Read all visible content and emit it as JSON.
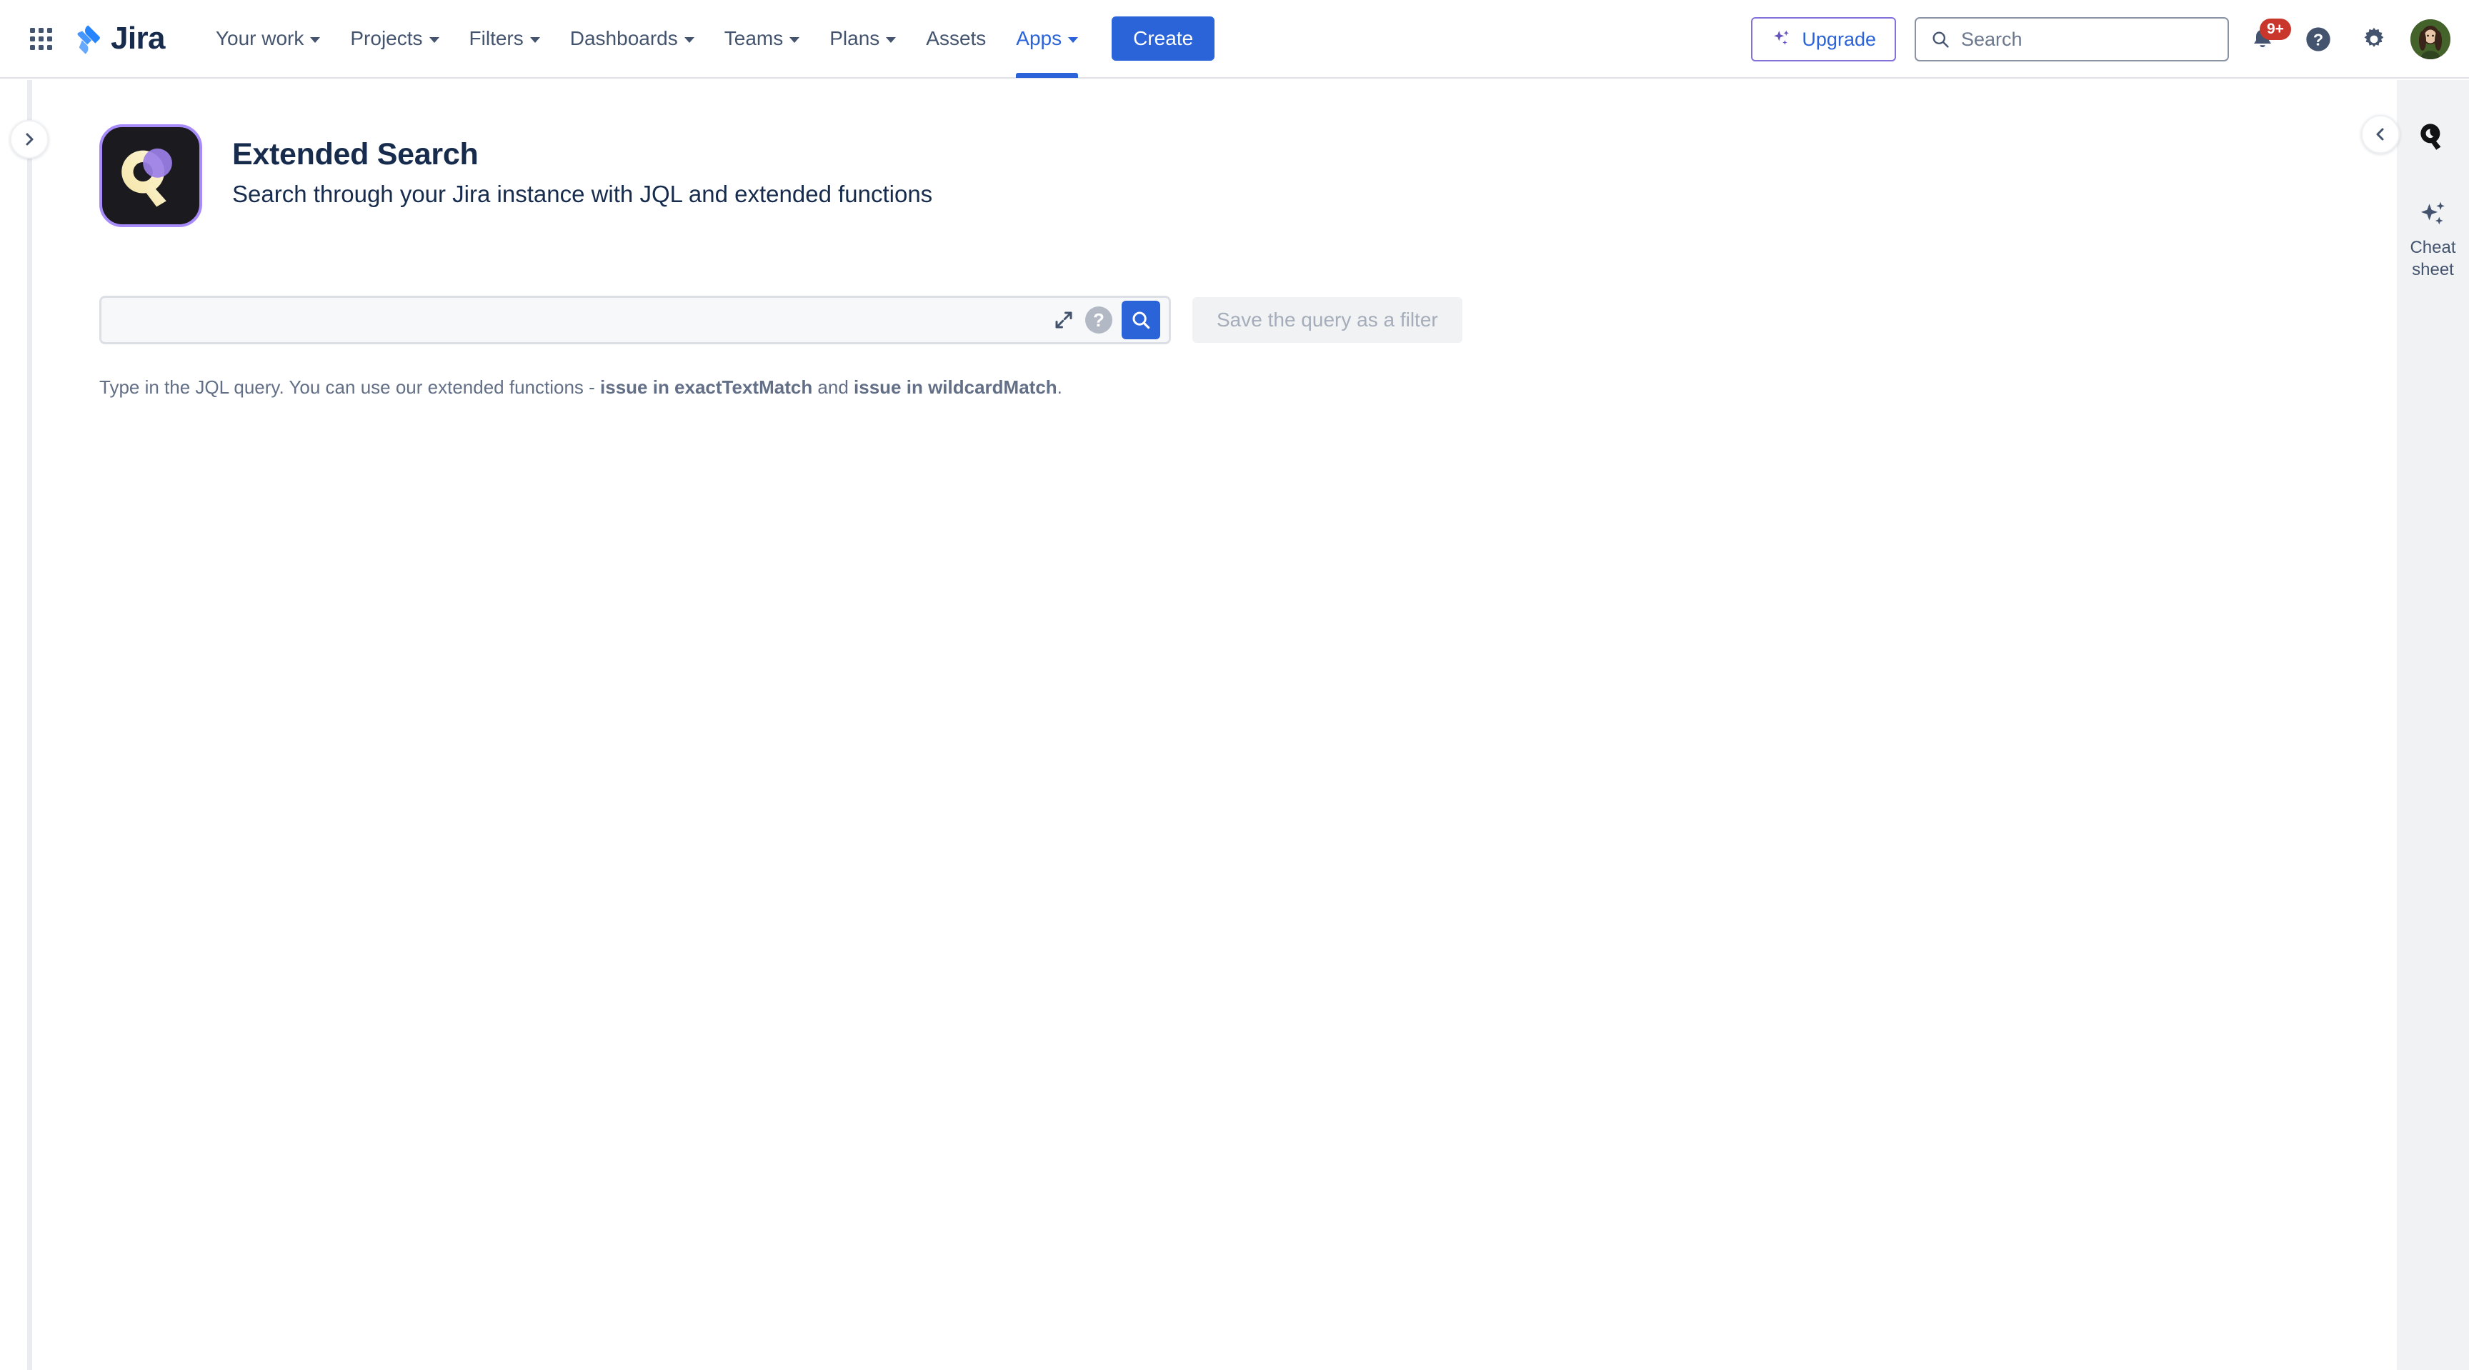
{
  "nav": {
    "app_switcher_icon": "grid-apps-icon",
    "brand": "Jira",
    "items": [
      {
        "label": "Your work",
        "has_dropdown": true,
        "active": false
      },
      {
        "label": "Projects",
        "has_dropdown": true,
        "active": false
      },
      {
        "label": "Filters",
        "has_dropdown": true,
        "active": false
      },
      {
        "label": "Dashboards",
        "has_dropdown": true,
        "active": false
      },
      {
        "label": "Teams",
        "has_dropdown": true,
        "active": false
      },
      {
        "label": "Plans",
        "has_dropdown": true,
        "active": false
      },
      {
        "label": "Assets",
        "has_dropdown": false,
        "active": false
      },
      {
        "label": "Apps",
        "has_dropdown": true,
        "active": true
      }
    ],
    "create_label": "Create",
    "upgrade_label": "Upgrade",
    "upgrade_icon": "sparkles-icon",
    "search_placeholder": "Search",
    "search_icon": "search-icon",
    "notifications_icon": "bell-icon",
    "notifications_badge": "9+",
    "help_icon": "question-circle-icon",
    "settings_icon": "gear-icon",
    "avatar_icon": "user-avatar"
  },
  "left_rail": {
    "expand_icon": "chevron-right-icon"
  },
  "right_rail": {
    "collapse_icon": "chevron-left-icon",
    "app_logo_icon": "extended-search-q-icon",
    "items": [
      {
        "icon": "sparkles-icon",
        "label_line1": "Cheat",
        "label_line2": "sheet"
      }
    ]
  },
  "app": {
    "logo_icon": "extended-search-logo",
    "title": "Extended Search",
    "subtitle": "Search through your Jira instance with JQL and extended functions"
  },
  "query": {
    "jql_value": "",
    "jql_placeholder": "",
    "expand_icon": "expand-arrows-icon",
    "help_icon": "help-question-icon",
    "search_icon": "search-icon",
    "search_button_label": "",
    "save_filter_label": "Save the query as a filter",
    "save_filter_disabled": true
  },
  "hint": {
    "prefix": "Type in the JQL query. You can use our extended functions - ",
    "fn1": "issue in exactTextMatch",
    "middle": " and ",
    "fn2": "issue in wildcardMatch",
    "suffix": "."
  },
  "colors": {
    "brand_blue": "#2B63D9",
    "upgrade_purple": "#8270DB",
    "badge_red": "#C9372C",
    "text_dark": "#172B4D",
    "text_muted": "#626F86",
    "rail_bg": "#F1F2F4",
    "field_bg": "#F7F8F9",
    "logo_purple": "#A78BFA"
  }
}
